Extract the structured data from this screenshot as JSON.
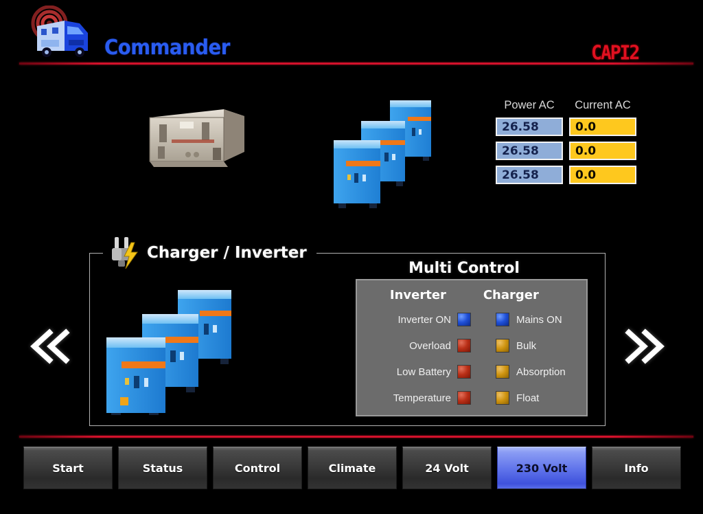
{
  "header": {
    "app_title": "Commander",
    "brand_logo": "CAPI2",
    "logo_icon": "rv-truck-radio-waves-logo"
  },
  "readouts": {
    "column_headers": [
      "Power AC",
      "Current AC"
    ],
    "rows": [
      {
        "power_ac": "26.58",
        "current_ac": "0.0"
      },
      {
        "power_ac": "26.58",
        "current_ac": "0.0"
      },
      {
        "power_ac": "26.58",
        "current_ac": "0.0"
      }
    ]
  },
  "devices": {
    "generator_label": "generator-unit-image",
    "inverter_stack_label": "inverter-stack-image"
  },
  "charger_section": {
    "legend": "Charger / Inverter",
    "icon": "plug-lightning-icon"
  },
  "multi_control": {
    "title": "Multi Control",
    "columns": [
      "Inverter",
      "Charger"
    ],
    "rows": [
      {
        "inverter_label": "Inverter ON",
        "inverter_led": "blue",
        "charger_led": "blue",
        "charger_label": "Mains ON"
      },
      {
        "inverter_label": "Overload",
        "inverter_led": "red",
        "charger_led": "amber",
        "charger_label": "Bulk"
      },
      {
        "inverter_label": "Low Battery",
        "inverter_led": "red",
        "charger_led": "amber",
        "charger_label": "Absorption"
      },
      {
        "inverter_label": "Temperature",
        "inverter_led": "red",
        "charger_led": "amber",
        "charger_label": "Float"
      }
    ],
    "led_colors": {
      "blue": "#1f4fd6",
      "red": "#b92f17",
      "amber": "#cf9410"
    }
  },
  "navigation": {
    "prev_icon": "double-chevron-left-icon",
    "next_icon": "double-chevron-right-icon"
  },
  "bottom_nav": {
    "buttons": [
      {
        "label": "Start",
        "active": false
      },
      {
        "label": "Status",
        "active": false
      },
      {
        "label": "Control",
        "active": false
      },
      {
        "label": "Climate",
        "active": false
      },
      {
        "label": "24 Volt",
        "active": false
      },
      {
        "label": "230 Volt",
        "active": true
      },
      {
        "label": "Info",
        "active": false
      }
    ]
  },
  "theme": {
    "background": "#000000",
    "accent_red": "#d4112b",
    "title_blue": "#2a5cf0",
    "value_blue": "#8fadd8",
    "value_yellow": "#fec81e",
    "panel_gray": "#6c6c6c",
    "active_button_blue": "#5e72ea"
  }
}
